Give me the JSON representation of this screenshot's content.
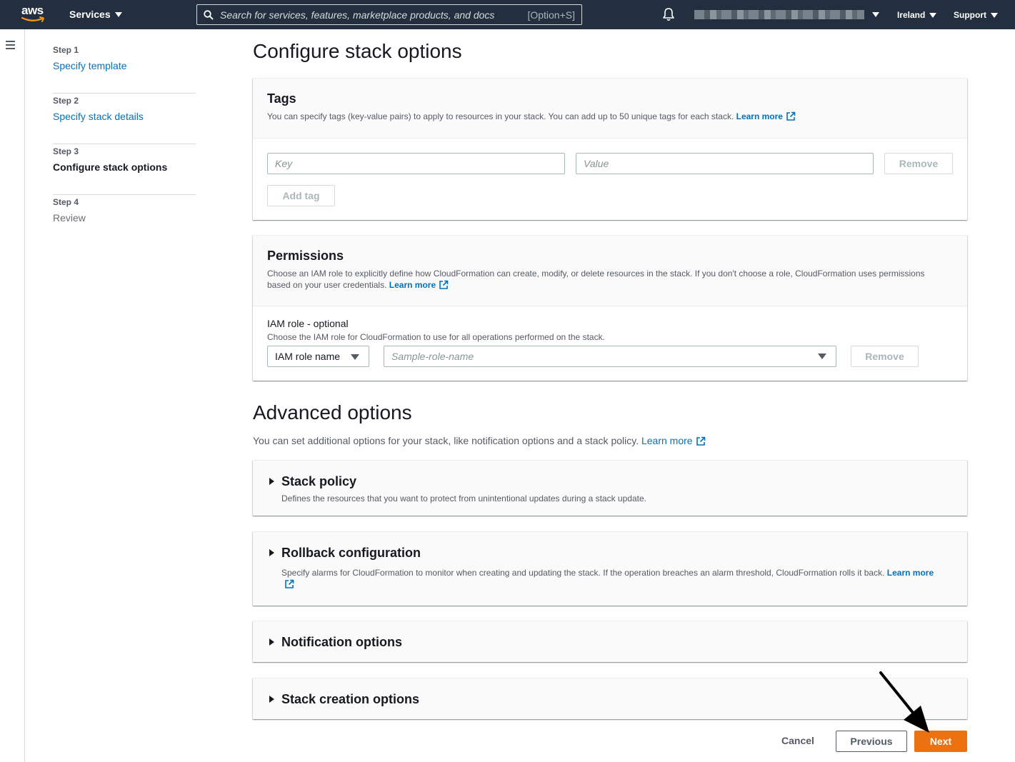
{
  "nav": {
    "logo_text": "aws",
    "services_label": "Services",
    "search_placeholder": "Search for services, features, marketplace products, and docs",
    "search_shortcut": "[Option+S]",
    "region_label": "Ireland",
    "support_label": "Support"
  },
  "steps": [
    {
      "step": "Step 1",
      "label": "Specify template",
      "state": "link"
    },
    {
      "step": "Step 2",
      "label": "Specify stack details",
      "state": "link"
    },
    {
      "step": "Step 3",
      "label": "Configure stack options",
      "state": "current"
    },
    {
      "step": "Step 4",
      "label": "Review",
      "state": "disabled"
    }
  ],
  "page_title": "Configure stack options",
  "tags": {
    "title": "Tags",
    "description": "You can specify tags (key-value pairs) to apply to resources in your stack. You can add up to 50 unique tags for each stack.",
    "learn_more": "Learn more",
    "key_placeholder": "Key",
    "value_placeholder": "Value",
    "remove_label": "Remove",
    "add_tag_label": "Add tag"
  },
  "permissions": {
    "title": "Permissions",
    "description": "Choose an IAM role to explicitly define how CloudFormation can create, modify, or delete resources in the stack. If you don't choose a role, CloudFormation uses permissions based on your user credentials.",
    "learn_more": "Learn more",
    "iam_label": "IAM role - optional",
    "iam_hint": "Choose the IAM role for CloudFormation to use for all operations performed on the stack.",
    "iam_type": "IAM role name",
    "role_placeholder": "Sample-role-name",
    "remove_label": "Remove"
  },
  "advanced": {
    "title": "Advanced options",
    "description": "You can set additional options for your stack, like notification options and a stack policy.",
    "learn_more": "Learn more",
    "sections": {
      "stack_policy": {
        "title": "Stack policy",
        "description": "Defines the resources that you want to protect from unintentional updates during a stack update."
      },
      "rollback": {
        "title": "Rollback configuration",
        "description": "Specify alarms for CloudFormation to monitor when creating and updating the stack. If the operation breaches an alarm threshold, CloudFormation rolls it back.",
        "learn_more": "Learn more"
      },
      "notification": {
        "title": "Notification options"
      },
      "creation": {
        "title": "Stack creation options"
      }
    }
  },
  "footer": {
    "cancel_label": "Cancel",
    "previous_label": "Previous",
    "next_label": "Next"
  },
  "colors": {
    "nav_bg": "#232f3e",
    "link": "#0073bb",
    "primary_button": "#ec7211"
  }
}
